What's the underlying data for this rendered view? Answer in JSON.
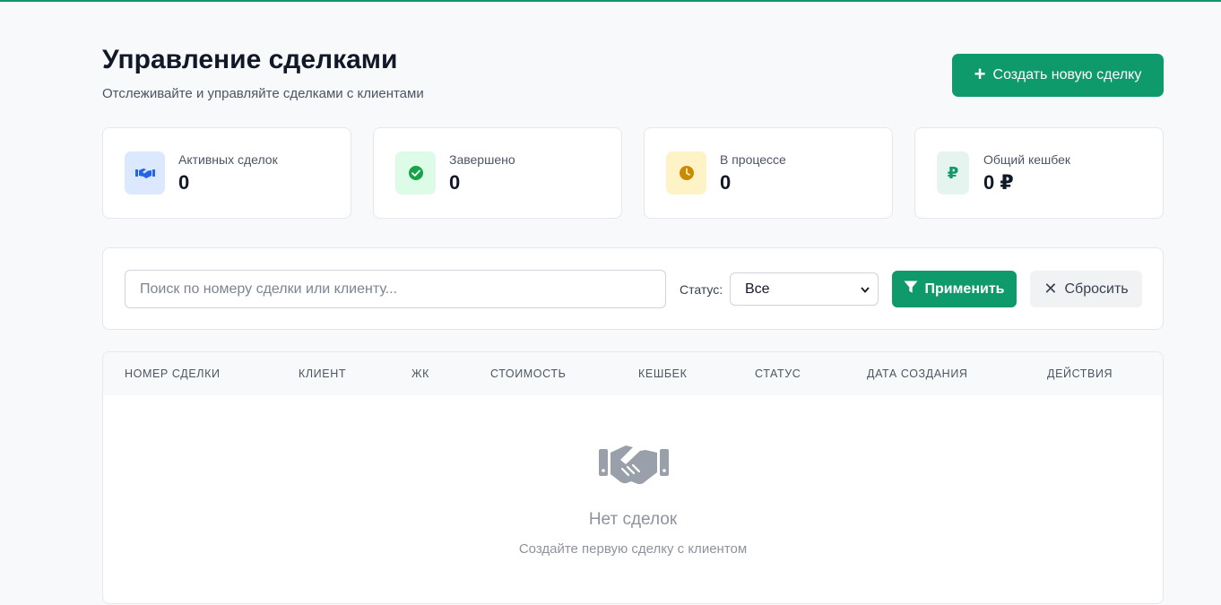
{
  "header": {
    "title": "Управление сделками",
    "subtitle": "Отслеживайте и управляйте сделками с клиентами",
    "create_button": "Создать новую сделку",
    "create_icon": "plus-icon"
  },
  "stats": [
    {
      "label": "Активных сделок",
      "value": "0",
      "icon": "handshake-icon",
      "icon_bg": "#dbe8fe",
      "icon_color": "#2563eb"
    },
    {
      "label": "Завершено",
      "value": "0",
      "icon": "check-circle-icon",
      "icon_bg": "#dcfce7",
      "icon_color": "#16a34a"
    },
    {
      "label": "В процессе",
      "value": "0",
      "icon": "clock-icon",
      "icon_bg": "#fef3c7",
      "icon_color": "#ca8a04"
    },
    {
      "label": "Общий кешбек",
      "value": "0 ₽",
      "icon": "ruble-icon",
      "icon_bg": "#e6f4ef",
      "icon_color": "#0f9a6b"
    }
  ],
  "filters": {
    "search_placeholder": "Поиск по номеру сделки или клиенту...",
    "search_value": "",
    "status_label": "Статус:",
    "status_selected": "Все",
    "apply_button": "Применить",
    "apply_icon": "filter-icon",
    "reset_button": "Сбросить",
    "reset_icon": "close-icon"
  },
  "table": {
    "columns": [
      "Номер сделки",
      "Клиент",
      "ЖК",
      "Стоимость",
      "Кешбек",
      "Статус",
      "Дата создания",
      "Действия"
    ],
    "rows": []
  },
  "empty_state": {
    "icon": "handshake-icon",
    "title": "Нет сделок",
    "subtitle": "Создайте первую сделку с клиентом"
  },
  "colors": {
    "accent": "#0f9a6b",
    "background": "#f8f9fb"
  }
}
